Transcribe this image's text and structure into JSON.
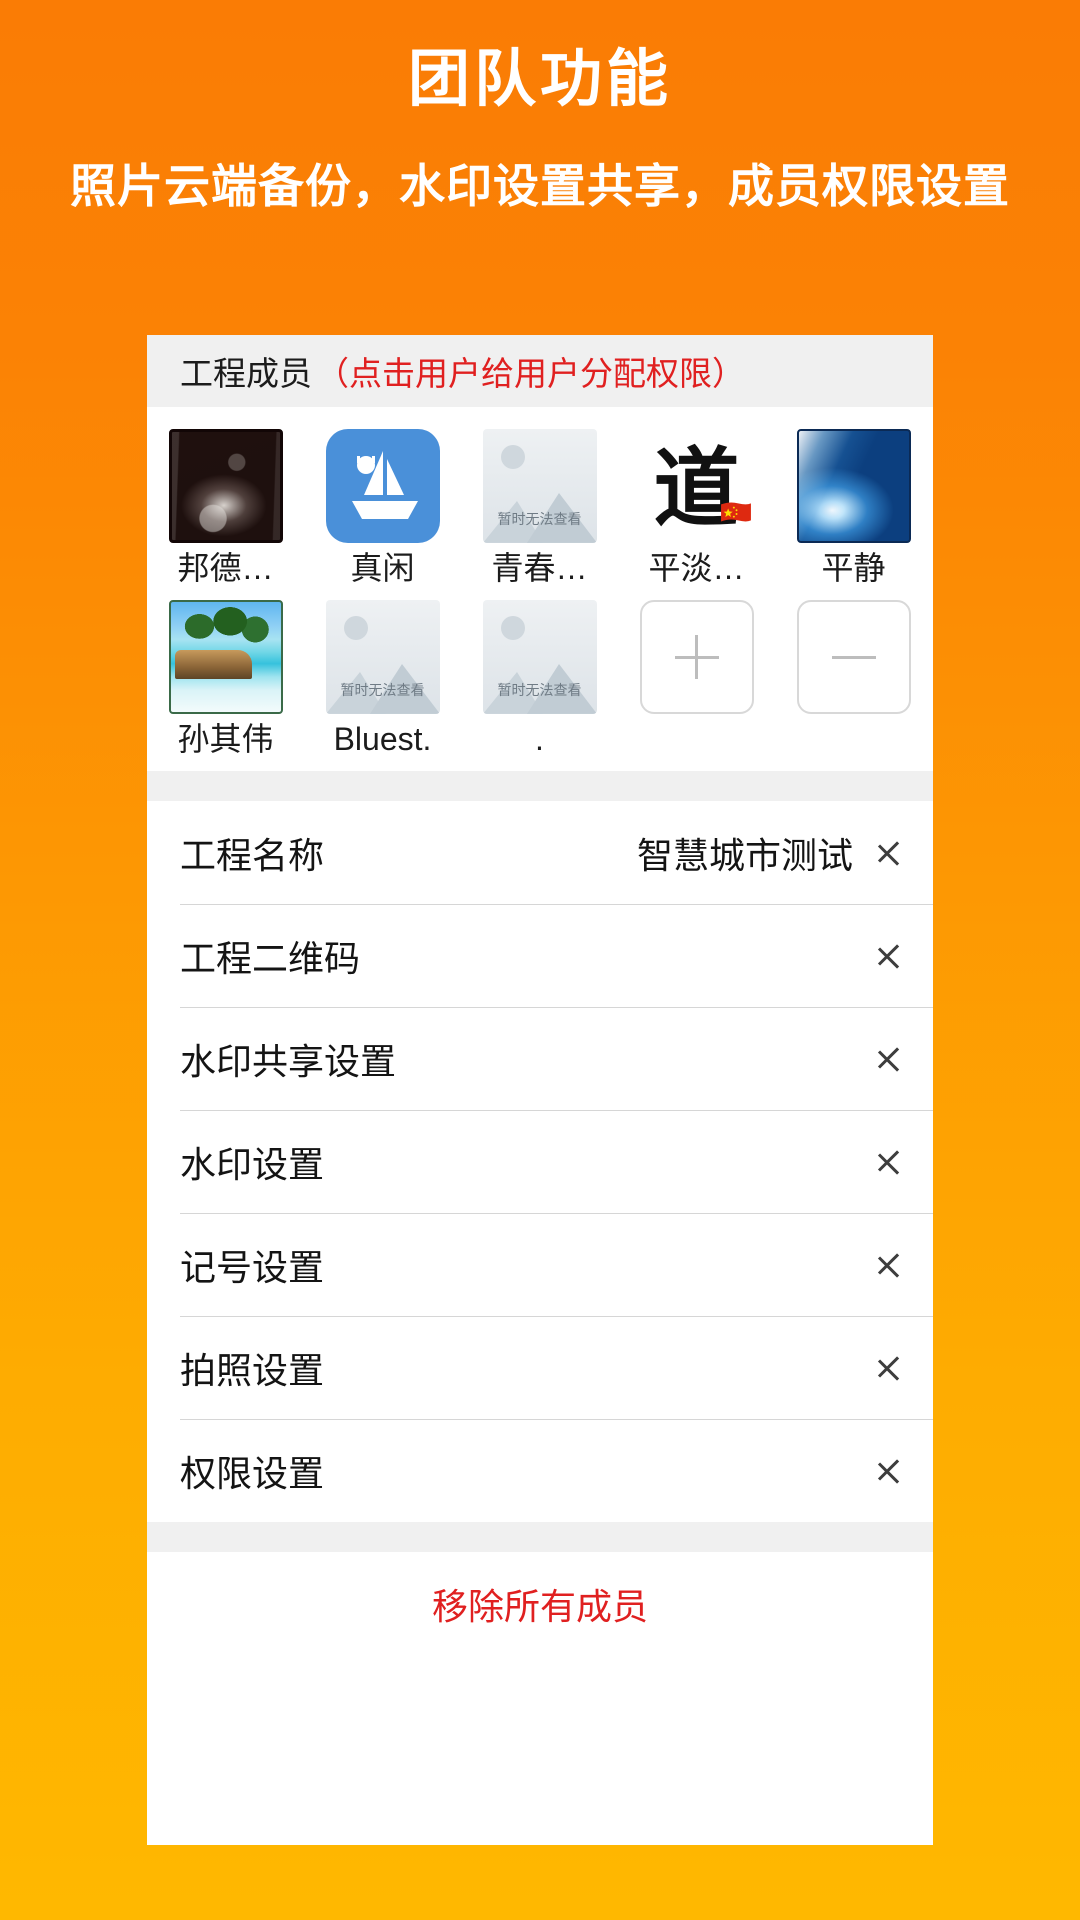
{
  "promo": {
    "title": "团队功能",
    "subtitle": "照片云端备份，水印设置共享，成员权限设置"
  },
  "members_section": {
    "title": "工程成员",
    "note": "（点击用户给用户分配权限）",
    "placeholder_text": "暂时无法查看",
    "members": [
      {
        "label": "邦德…",
        "avatar": "photo-dark-portrait"
      },
      {
        "label": "真闲",
        "avatar": "sailboat-icon"
      },
      {
        "label": "青春…",
        "avatar": "image-placeholder"
      },
      {
        "label": "平淡…",
        "avatar": "dao-calligraphy-flag"
      },
      {
        "label": "平静",
        "avatar": "blue-wave-photo"
      },
      {
        "label": "孙其伟",
        "avatar": "beach-photo"
      },
      {
        "label": "Bluest.",
        "avatar": "image-placeholder"
      },
      {
        "label": ".",
        "avatar": "image-placeholder"
      }
    ],
    "add_button_label": "+",
    "remove_button_label": "−"
  },
  "settings": {
    "rows": [
      {
        "label": "工程名称",
        "value": "智慧城市测试"
      },
      {
        "label": "工程二维码",
        "value": ""
      },
      {
        "label": "水印共享设置",
        "value": ""
      },
      {
        "label": "水印设置",
        "value": ""
      },
      {
        "label": "记号设置",
        "value": ""
      },
      {
        "label": "拍照设置",
        "value": ""
      },
      {
        "label": "权限设置",
        "value": ""
      }
    ]
  },
  "footer": {
    "remove_all_label": "移除所有成员"
  },
  "colors": {
    "bg_top": "#FA7C05",
    "bg_bottom": "#FFB800",
    "accent_red": "#E02020",
    "card_bg": "#FFFFFF",
    "section_gray": "#F0F0F0"
  }
}
